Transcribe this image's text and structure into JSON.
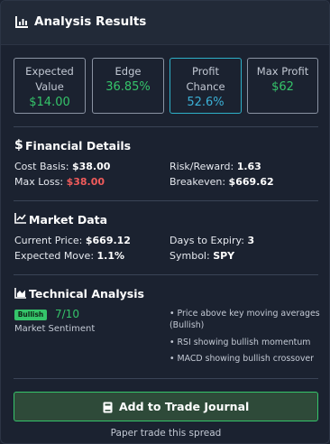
{
  "header": {
    "title": "Analysis Results",
    "icon": "bar-chart-icon"
  },
  "metrics": [
    {
      "label_line1": "Expected",
      "label_line2": "Value",
      "value": "$14.00",
      "color": "#35c46a"
    },
    {
      "label_line1": "Edge",
      "value": "36.85%",
      "color": "#35c46a"
    },
    {
      "label_line1": "Profit",
      "label_line2": "Chance",
      "value": "52.6%",
      "color": "#3bb0d6"
    },
    {
      "label_line1": "Max Profit",
      "value": "$62",
      "color": "#35c46a"
    }
  ],
  "financial": {
    "title": "Financial Details",
    "icon": "dollar-icon",
    "cost_basis_label": "Cost Basis:",
    "cost_basis": "$38.00",
    "max_loss_label": "Max Loss:",
    "max_loss": "$38.00",
    "risk_reward_label": "Risk/Reward:",
    "risk_reward": "1.63",
    "breakeven_label": "Breakeven:",
    "breakeven": "$669.62"
  },
  "market": {
    "title": "Market Data",
    "icon": "line-chart-icon",
    "current_price_label": "Current Price:",
    "current_price": "$669.12",
    "expected_move_label": "Expected Move:",
    "expected_move": "1.1%",
    "days_to_expiry_label": "Days to Expiry:",
    "days_to_expiry": "3",
    "symbol_label": "Symbol:",
    "symbol": "SPY"
  },
  "technical": {
    "title": "Technical Analysis",
    "icon": "area-chart-icon",
    "badge": "Bullish",
    "score": "7/10",
    "sentiment_label": "Market Sentiment",
    "bullets": [
      "• Price above key moving averages",
      "(Bullish)",
      "• RSI showing bullish momentum",
      "• MACD showing bullish crossover"
    ]
  },
  "action": {
    "button_label": "Add to Trade Journal",
    "icon": "journal-icon",
    "caption": "Paper trade this spread"
  },
  "colors": {
    "green": "#35c46a",
    "red": "#ef5b5b",
    "blue": "#3bb0d6",
    "background": "#1b2230"
  }
}
